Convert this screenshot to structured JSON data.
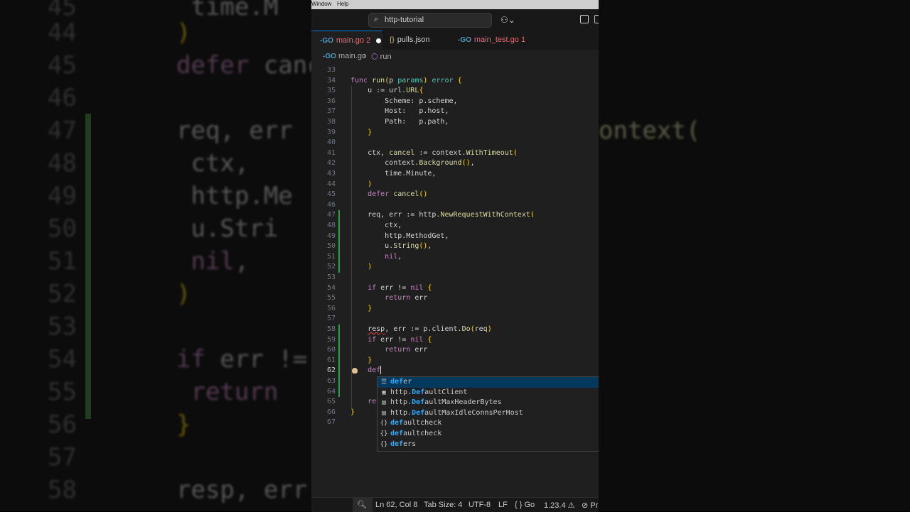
{
  "menubar": {
    "window": "Window",
    "help": "Help"
  },
  "title": {
    "search_text": "http-tutorial"
  },
  "tabs": [
    {
      "label": "main.go",
      "badge": "2",
      "color": "#e06c75"
    },
    {
      "label": "pulls.json",
      "color": "#cccccc"
    },
    {
      "label": "main_test.go",
      "badge": "1",
      "color": "#e06c75"
    }
  ],
  "breadcrumb": {
    "file": "main.go",
    "symbol": "run"
  },
  "lines": [
    {
      "n": "33",
      "code": ""
    },
    {
      "n": "34",
      "code": "func run(p params) error {"
    },
    {
      "n": "35",
      "code": "    u := url.URL{"
    },
    {
      "n": "36",
      "code": "        Scheme: p.scheme,"
    },
    {
      "n": "37",
      "code": "        Host:   p.host,"
    },
    {
      "n": "38",
      "code": "        Path:   p.path,"
    },
    {
      "n": "39",
      "code": "    }"
    },
    {
      "n": "40",
      "code": ""
    },
    {
      "n": "41",
      "code": "    ctx, cancel := context.WithTimeout("
    },
    {
      "n": "42",
      "code": "        context.Background(),"
    },
    {
      "n": "43",
      "code": "        time.Minute,"
    },
    {
      "n": "44",
      "code": "    )"
    },
    {
      "n": "45",
      "code": "    defer cancel()"
    },
    {
      "n": "46",
      "code": ""
    },
    {
      "n": "47",
      "code": "    req, err := http.NewRequestWithContext("
    },
    {
      "n": "48",
      "code": "        ctx,"
    },
    {
      "n": "49",
      "code": "        http.MethodGet,"
    },
    {
      "n": "50",
      "code": "        u.String(),"
    },
    {
      "n": "51",
      "code": "        nil,"
    },
    {
      "n": "52",
      "code": "    )"
    },
    {
      "n": "53",
      "code": ""
    },
    {
      "n": "54",
      "code": "    if err != nil {"
    },
    {
      "n": "55",
      "code": "        return err"
    },
    {
      "n": "56",
      "code": "    }"
    },
    {
      "n": "57",
      "code": ""
    },
    {
      "n": "58",
      "code": "    resp, err := p.client.Do(req)"
    },
    {
      "n": "59",
      "code": "    if err != nil {"
    },
    {
      "n": "60",
      "code": "        return err"
    },
    {
      "n": "61",
      "code": "    }"
    },
    {
      "n": "62",
      "code": "    def"
    },
    {
      "n": "63",
      "code": ""
    },
    {
      "n": "64",
      "code": ""
    },
    {
      "n": "65",
      "code": "    ret"
    },
    {
      "n": "66",
      "code": "}"
    },
    {
      "n": "67",
      "code": ""
    }
  ],
  "suggestions": [
    {
      "icon": "keyword-icon",
      "glyph": "☰",
      "match": "def",
      "rest": "er",
      "prefix": ""
    },
    {
      "icon": "variable-icon",
      "glyph": "▣",
      "prefix": "http.",
      "match": "Def",
      "rest": "aultClient"
    },
    {
      "icon": "constant-icon",
      "glyph": "▤",
      "prefix": "http.",
      "match": "Def",
      "rest": "aultMaxHeaderBytes"
    },
    {
      "icon": "constant-icon",
      "glyph": "▤",
      "prefix": "http.",
      "match": "Def",
      "rest": "aultMaxIdleConnsPerHost"
    },
    {
      "icon": "snippet-icon",
      "glyph": "{}",
      "prefix": "",
      "match": "def",
      "rest": "aultcheck"
    },
    {
      "icon": "snippet-icon",
      "glyph": "{}",
      "prefix": "",
      "match": "def",
      "rest": "aultcheck"
    },
    {
      "icon": "snippet-icon",
      "glyph": "{}",
      "prefix": "",
      "match": "def",
      "rest": "ers"
    }
  ],
  "status": {
    "position": "Ln 62, Col 8",
    "tab_size": "Tab Size: 4",
    "encoding": "UTF-8",
    "eol": "LF",
    "language": "Go",
    "version": "1.23.4",
    "extra": "Pr"
  },
  "background": {
    "left": [
      {
        "n": "45",
        "code": "    time.M"
      },
      {
        "n": "44",
        "code": ")"
      },
      {
        "n": "45",
        "code": "defer cance"
      },
      {
        "n": "46",
        "code": ""
      },
      {
        "n": "47",
        "code": "req, err :="
      },
      {
        "n": "48",
        "code": "    ctx,"
      },
      {
        "n": "49",
        "code": "    http.Me"
      },
      {
        "n": "50",
        "code": "    u.Stri"
      },
      {
        "n": "51",
        "code": "    nil,"
      },
      {
        "n": "52",
        "code": ")"
      },
      {
        "n": "53",
        "code": ""
      },
      {
        "n": "54",
        "code": "if err != n"
      },
      {
        "n": "55",
        "code": "    return"
      },
      {
        "n": "56",
        "code": "}"
      },
      {
        "n": "57",
        "code": ""
      },
      {
        "n": "58",
        "code": "resp, err "
      }
    ],
    "right_fragment": "ontext("
  }
}
